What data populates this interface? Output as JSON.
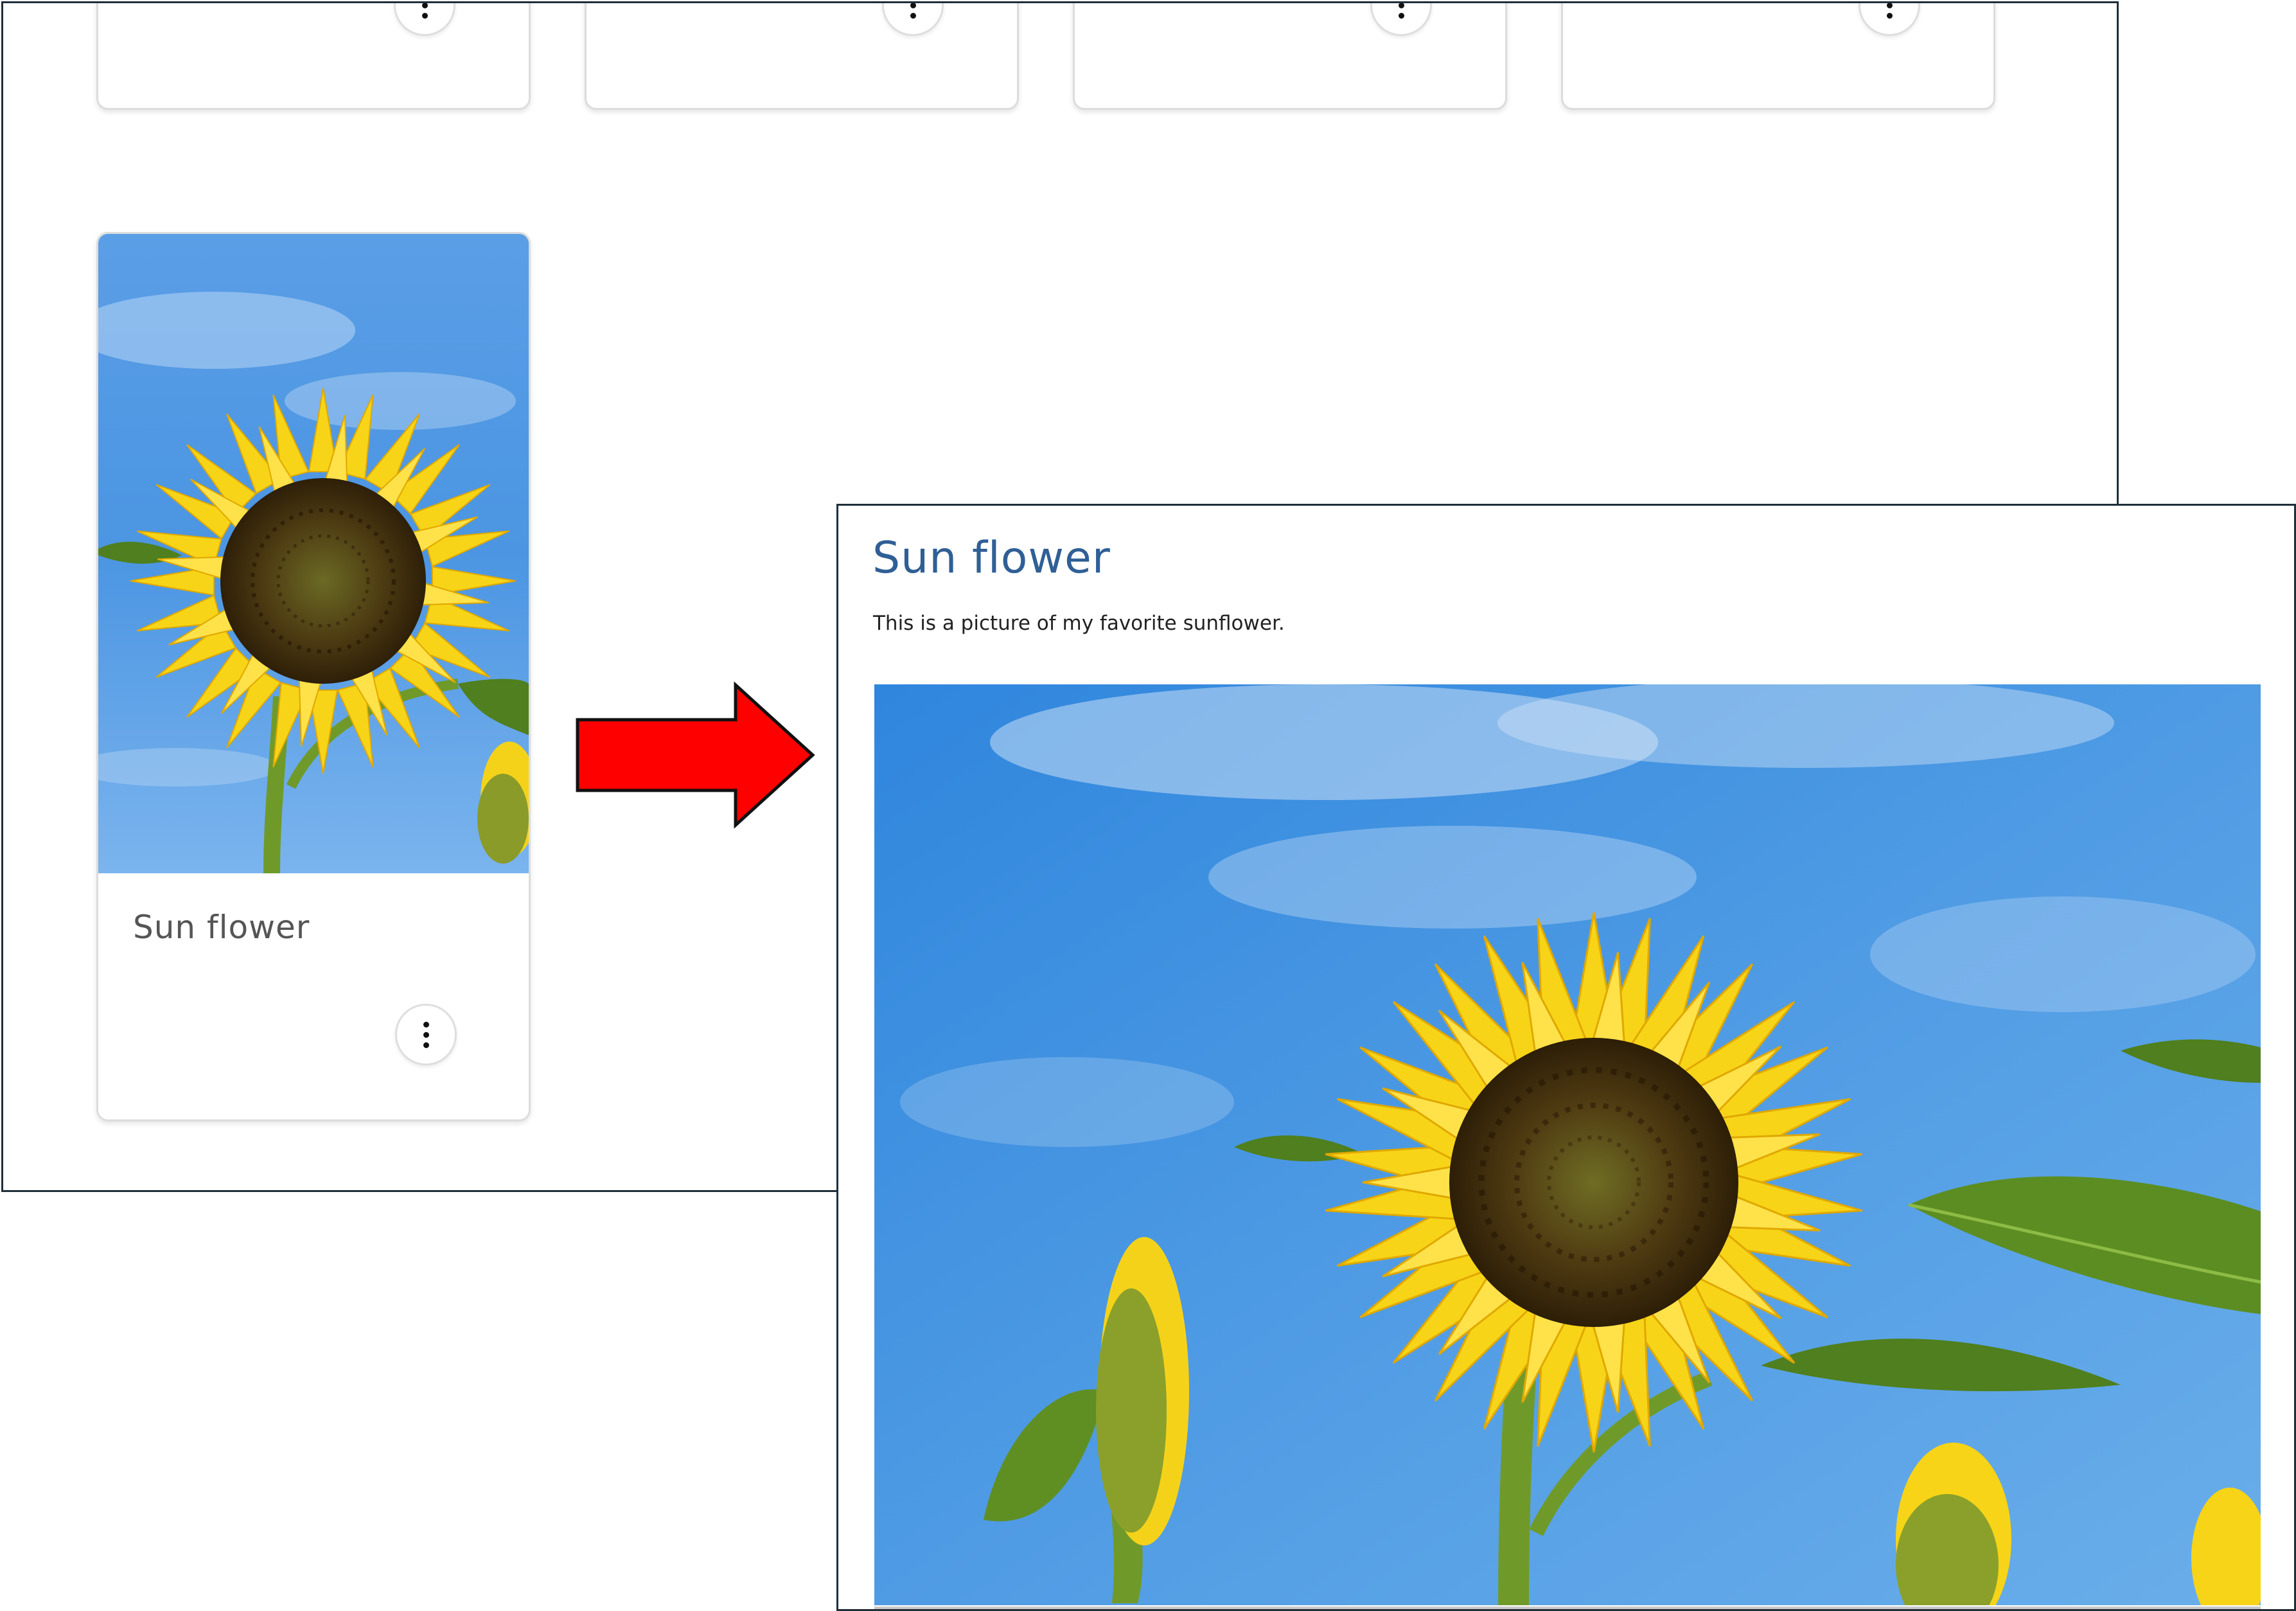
{
  "gallery": {
    "card": {
      "title": "Sun flower",
      "menu_icon": "more-vertical-icon"
    }
  },
  "detail": {
    "title": "Sun flower",
    "description": "This is a picture of my favorite sunflower."
  },
  "colors": {
    "detail_title": "#2f5f95",
    "card_title": "#555555",
    "arrow_fill": "#ff0000",
    "window_border": "#1f2f3a",
    "sky_blue": "#3c8ee0",
    "petal_yellow": "#f7d417"
  }
}
